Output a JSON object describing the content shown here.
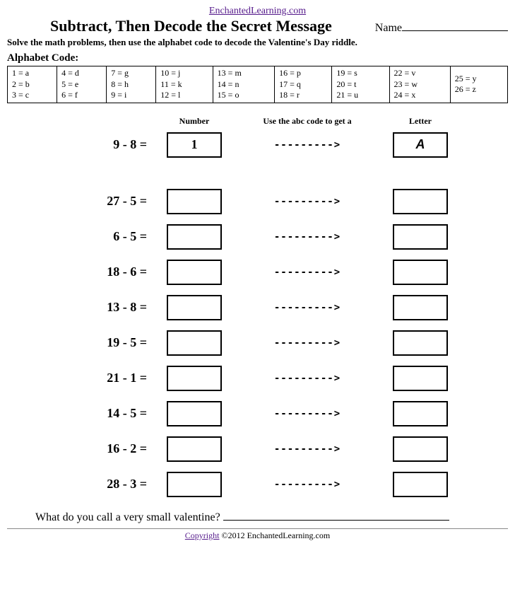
{
  "topLink": "EnchantedLearning.com",
  "title": "Subtract, Then Decode the Secret Message",
  "nameLabel": "Name",
  "subtitle": "Solve the math problems, then use the alphabet code to decode the Valentine's Day riddle.",
  "codeLabel": "Alphabet Code:",
  "codeTable": [
    [
      "1 = a",
      "2 = b",
      "3 = c"
    ],
    [
      "4 = d",
      "5 = e",
      "6 = f"
    ],
    [
      "7 = g",
      "8 = h",
      "9 = i"
    ],
    [
      "10 = j",
      "11 = k",
      "12 = l"
    ],
    [
      "13 = m",
      "14 = n",
      "15 = o"
    ],
    [
      "16 = p",
      "17 = q",
      "18 = r"
    ],
    [
      "19 = s",
      "20 = t",
      "21 = u"
    ],
    [
      "22 = v",
      "23 = w",
      "24 = x"
    ],
    [
      "25 = y",
      "26 = z"
    ]
  ],
  "headers": {
    "number": "Number",
    "middle": "Use the abc code to get a",
    "letter": "Letter"
  },
  "arrow": "--------->",
  "rows": [
    {
      "problem": "9 - 8 =",
      "number": "1",
      "letter": "A"
    },
    {
      "problem": "27 - 5 =",
      "number": "",
      "letter": ""
    },
    {
      "problem": "6 - 5 =",
      "number": "",
      "letter": ""
    },
    {
      "problem": "18 - 6 =",
      "number": "",
      "letter": ""
    },
    {
      "problem": "13 - 8 =",
      "number": "",
      "letter": ""
    },
    {
      "problem": "19 - 5 =",
      "number": "",
      "letter": ""
    },
    {
      "problem": "21 - 1 =",
      "number": "",
      "letter": ""
    },
    {
      "problem": "14 - 5 =",
      "number": "",
      "letter": ""
    },
    {
      "problem": "16 - 2 =",
      "number": "",
      "letter": ""
    },
    {
      "problem": "28 - 3 =",
      "number": "",
      "letter": ""
    }
  ],
  "riddle": "What do you call a very small valentine? ",
  "footer": {
    "copyrightLink": "Copyright",
    "rest": " ©2012 EnchantedLearning.com"
  }
}
